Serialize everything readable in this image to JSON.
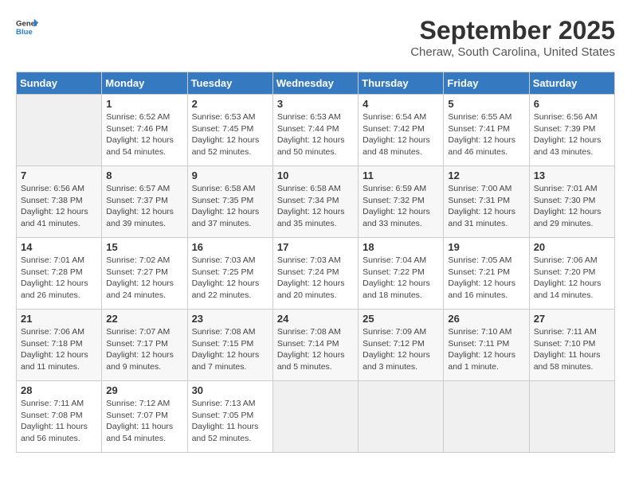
{
  "header": {
    "logo_line1": "General",
    "logo_line2": "Blue",
    "month": "September 2025",
    "location": "Cheraw, South Carolina, United States"
  },
  "weekdays": [
    "Sunday",
    "Monday",
    "Tuesday",
    "Wednesday",
    "Thursday",
    "Friday",
    "Saturday"
  ],
  "weeks": [
    [
      {
        "day": "",
        "info": ""
      },
      {
        "day": "1",
        "info": "Sunrise: 6:52 AM\nSunset: 7:46 PM\nDaylight: 12 hours\nand 54 minutes."
      },
      {
        "day": "2",
        "info": "Sunrise: 6:53 AM\nSunset: 7:45 PM\nDaylight: 12 hours\nand 52 minutes."
      },
      {
        "day": "3",
        "info": "Sunrise: 6:53 AM\nSunset: 7:44 PM\nDaylight: 12 hours\nand 50 minutes."
      },
      {
        "day": "4",
        "info": "Sunrise: 6:54 AM\nSunset: 7:42 PM\nDaylight: 12 hours\nand 48 minutes."
      },
      {
        "day": "5",
        "info": "Sunrise: 6:55 AM\nSunset: 7:41 PM\nDaylight: 12 hours\nand 46 minutes."
      },
      {
        "day": "6",
        "info": "Sunrise: 6:56 AM\nSunset: 7:39 PM\nDaylight: 12 hours\nand 43 minutes."
      }
    ],
    [
      {
        "day": "7",
        "info": "Sunrise: 6:56 AM\nSunset: 7:38 PM\nDaylight: 12 hours\nand 41 minutes."
      },
      {
        "day": "8",
        "info": "Sunrise: 6:57 AM\nSunset: 7:37 PM\nDaylight: 12 hours\nand 39 minutes."
      },
      {
        "day": "9",
        "info": "Sunrise: 6:58 AM\nSunset: 7:35 PM\nDaylight: 12 hours\nand 37 minutes."
      },
      {
        "day": "10",
        "info": "Sunrise: 6:58 AM\nSunset: 7:34 PM\nDaylight: 12 hours\nand 35 minutes."
      },
      {
        "day": "11",
        "info": "Sunrise: 6:59 AM\nSunset: 7:32 PM\nDaylight: 12 hours\nand 33 minutes."
      },
      {
        "day": "12",
        "info": "Sunrise: 7:00 AM\nSunset: 7:31 PM\nDaylight: 12 hours\nand 31 minutes."
      },
      {
        "day": "13",
        "info": "Sunrise: 7:01 AM\nSunset: 7:30 PM\nDaylight: 12 hours\nand 29 minutes."
      }
    ],
    [
      {
        "day": "14",
        "info": "Sunrise: 7:01 AM\nSunset: 7:28 PM\nDaylight: 12 hours\nand 26 minutes."
      },
      {
        "day": "15",
        "info": "Sunrise: 7:02 AM\nSunset: 7:27 PM\nDaylight: 12 hours\nand 24 minutes."
      },
      {
        "day": "16",
        "info": "Sunrise: 7:03 AM\nSunset: 7:25 PM\nDaylight: 12 hours\nand 22 minutes."
      },
      {
        "day": "17",
        "info": "Sunrise: 7:03 AM\nSunset: 7:24 PM\nDaylight: 12 hours\nand 20 minutes."
      },
      {
        "day": "18",
        "info": "Sunrise: 7:04 AM\nSunset: 7:22 PM\nDaylight: 12 hours\nand 18 minutes."
      },
      {
        "day": "19",
        "info": "Sunrise: 7:05 AM\nSunset: 7:21 PM\nDaylight: 12 hours\nand 16 minutes."
      },
      {
        "day": "20",
        "info": "Sunrise: 7:06 AM\nSunset: 7:20 PM\nDaylight: 12 hours\nand 14 minutes."
      }
    ],
    [
      {
        "day": "21",
        "info": "Sunrise: 7:06 AM\nSunset: 7:18 PM\nDaylight: 12 hours\nand 11 minutes."
      },
      {
        "day": "22",
        "info": "Sunrise: 7:07 AM\nSunset: 7:17 PM\nDaylight: 12 hours\nand 9 minutes."
      },
      {
        "day": "23",
        "info": "Sunrise: 7:08 AM\nSunset: 7:15 PM\nDaylight: 12 hours\nand 7 minutes."
      },
      {
        "day": "24",
        "info": "Sunrise: 7:08 AM\nSunset: 7:14 PM\nDaylight: 12 hours\nand 5 minutes."
      },
      {
        "day": "25",
        "info": "Sunrise: 7:09 AM\nSunset: 7:12 PM\nDaylight: 12 hours\nand 3 minutes."
      },
      {
        "day": "26",
        "info": "Sunrise: 7:10 AM\nSunset: 7:11 PM\nDaylight: 12 hours\nand 1 minute."
      },
      {
        "day": "27",
        "info": "Sunrise: 7:11 AM\nSunset: 7:10 PM\nDaylight: 11 hours\nand 58 minutes."
      }
    ],
    [
      {
        "day": "28",
        "info": "Sunrise: 7:11 AM\nSunset: 7:08 PM\nDaylight: 11 hours\nand 56 minutes."
      },
      {
        "day": "29",
        "info": "Sunrise: 7:12 AM\nSunset: 7:07 PM\nDaylight: 11 hours\nand 54 minutes."
      },
      {
        "day": "30",
        "info": "Sunrise: 7:13 AM\nSunset: 7:05 PM\nDaylight: 11 hours\nand 52 minutes."
      },
      {
        "day": "",
        "info": ""
      },
      {
        "day": "",
        "info": ""
      },
      {
        "day": "",
        "info": ""
      },
      {
        "day": "",
        "info": ""
      }
    ]
  ]
}
